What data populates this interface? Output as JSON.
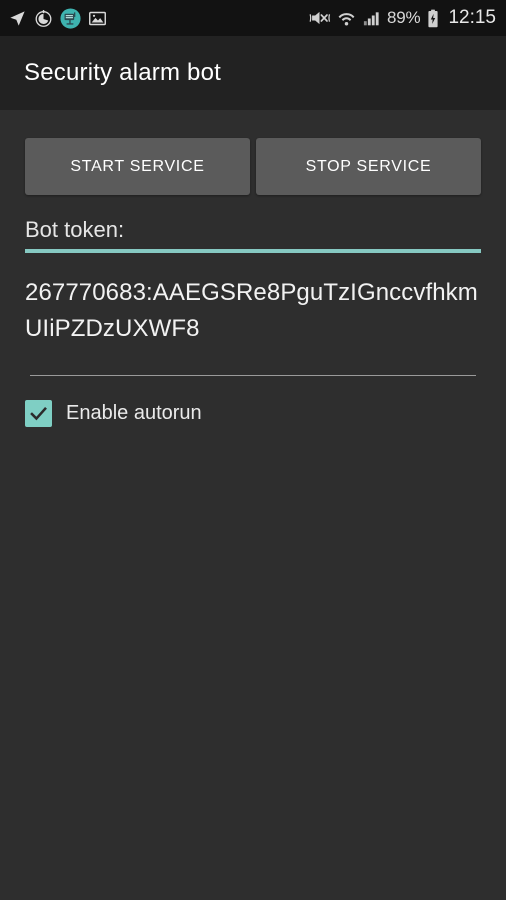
{
  "status_bar": {
    "left_icons": [
      {
        "name": "location-icon",
        "label": "Location"
      },
      {
        "name": "alarm-icon",
        "label": "Alarm"
      },
      {
        "name": "app-notification-icon",
        "label": "Security alarm bot"
      },
      {
        "name": "image-icon",
        "label": "Screenshot captured"
      }
    ],
    "right_icons": [
      {
        "name": "mute-vibrate-icon",
        "label": "Sound off"
      },
      {
        "name": "wifi-icon",
        "label": "Wi-Fi"
      },
      {
        "name": "cellular-signal-icon",
        "label": "Cellular signal"
      }
    ],
    "battery_percent": "89%",
    "battery_state": "charging",
    "clock": "12:15"
  },
  "app_bar": {
    "title": "Security alarm bot"
  },
  "main": {
    "start_button_label": "START SERVICE",
    "stop_button_label": "STOP SERVICE",
    "token_field": {
      "label": "Bot token:",
      "value": "267770683:AAEGSRe8PguTzIGnccvfhkmUIiPZDzUXWF8",
      "placeholder": "Bot token"
    },
    "autorun": {
      "label": "Enable autorun",
      "checked": true,
      "check_glyph": "✓"
    }
  },
  "colors": {
    "status_bar_bg": "#121212",
    "app_bar_bg": "#222222",
    "content_bg": "#2e2e2e",
    "button_bg": "#5b5b5b",
    "accent_teal": "#86c9c2",
    "checkbox_fill": "#7fcfc4",
    "text_primary": "#ffffff"
  }
}
